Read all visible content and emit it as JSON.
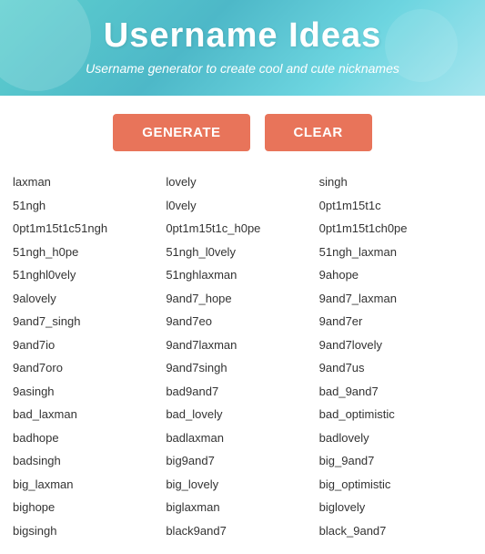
{
  "header": {
    "title": "Username Ideas",
    "subtitle": "Username generator to create cool and cute nicknames"
  },
  "buttons": {
    "generate": "GENERATE",
    "clear": "CLEAR"
  },
  "columns": [
    {
      "items": [
        "laxman",
        "51ngh",
        "0pt1m15t1c51ngh",
        "51ngh_h0pe",
        "51nghl0vely",
        "9alovely",
        "9and7_singh",
        "9and7io",
        "9and7oro",
        "9asingh",
        "bad_laxman",
        "badhope",
        "badsingh",
        "big_laxman",
        "bighope",
        "bigsingh"
      ]
    },
    {
      "items": [
        "lovely",
        "l0vely",
        "0pt1m15t1c_h0pe",
        "51ngh_l0vely",
        "51nghlaxman",
        "9and7_hope",
        "9and7eo",
        "9and7laxman",
        "9and7singh",
        "bad9and7",
        "bad_lovely",
        "badlaxman",
        "big9and7",
        "big_lovely",
        "biglaxman",
        "black9and7"
      ]
    },
    {
      "items": [
        "singh",
        "0pt1m15t1c",
        "0pt1m15t1ch0pe",
        "51ngh_laxman",
        "9ahope",
        "9and7_laxman",
        "9and7er",
        "9and7lovely",
        "9and7us",
        "bad_9and7",
        "bad_optimistic",
        "badlovely",
        "big_9and7",
        "big_optimistic",
        "biglovely",
        "black_9and7"
      ]
    }
  ]
}
